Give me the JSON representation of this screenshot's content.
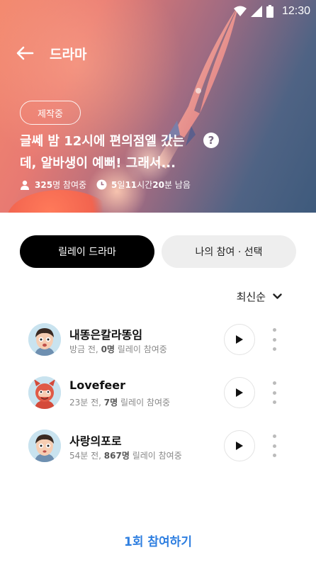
{
  "status_bar": {
    "time": "12:30"
  },
  "header": {
    "title": "드라마"
  },
  "story": {
    "badge": "제작중",
    "title_line1": "글쎄 밤 12시에 편의점엘 갔는",
    "title_line2": "데, 알바생이 예뻐! 그래서...",
    "participants_num": "325",
    "participants_suffix": "명 참여중",
    "time_days": "5",
    "time_days_suffix": "일 ",
    "time_hours": "11",
    "time_hours_suffix": "시간 ",
    "time_minutes": "20",
    "time_minutes_suffix": "분 남음"
  },
  "tabs": [
    {
      "label": "릴레이 드라마",
      "active": true
    },
    {
      "label": "나의 참여 · 선택",
      "active": false
    }
  ],
  "sort": {
    "label": "최신순"
  },
  "relays": [
    {
      "name": "내똥은칼라똥임",
      "time": "방금 전, ",
      "count": "0명",
      "suffix": " 릴레이 참여중",
      "avatar": "boy-avatar"
    },
    {
      "name": "Lovefeer",
      "time": "23분 전, ",
      "count": "7명",
      "suffix": " 릴레이 참여중",
      "avatar": "devil-avatar"
    },
    {
      "name": "사랑의포로",
      "time": "54분 전, ",
      "count": "867명",
      "suffix": " 릴레이 참여중",
      "avatar": "boy-avatar"
    }
  ],
  "footer": {
    "join_label": "1회 참여하기"
  },
  "colors": {
    "primary_blue": "#2f7fe0",
    "active_tab": "#000000",
    "hero_start": "#f3896e",
    "hero_end": "#3e5a7c"
  }
}
